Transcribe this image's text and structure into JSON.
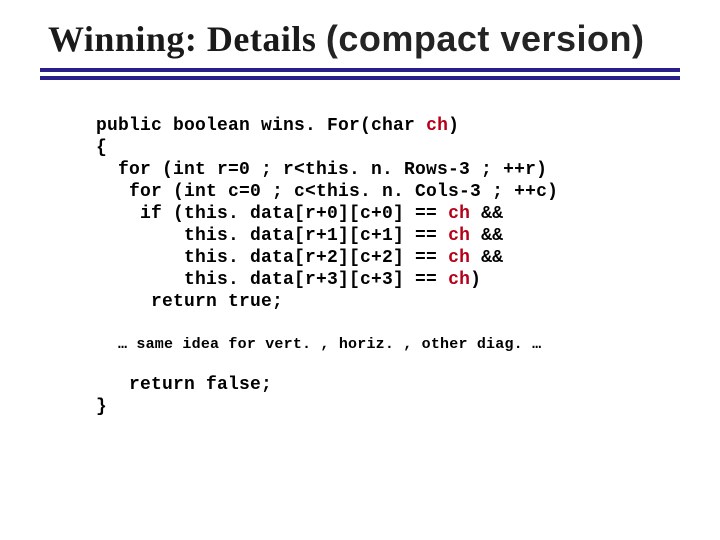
{
  "title": {
    "left": "Winning:  Details",
    "right": "(compact version)"
  },
  "code": {
    "l1a": "public boolean wins. For(char ",
    "l1b": "ch",
    "l1c": ")",
    "l2": "{",
    "l3": "  for (int r=0 ; r<this. n. Rows-3 ; ++r)",
    "l4": "   for (int c=0 ; c<this. n. Cols-3 ; ++c)",
    "l5a": "    if (this. data[r+0][c+0] == ",
    "l5b": "ch",
    "l5c": " &&",
    "l6a": "        this. data[r+1][c+1] == ",
    "l6b": "ch",
    "l6c": " &&",
    "l7a": "        this. data[r+2][c+2] == ",
    "l7b": "ch",
    "l7c": " &&",
    "l8a": "        this. data[r+3][c+3] == ",
    "l8b": "ch",
    "l8c": ")",
    "l9": "     return true;",
    "note": "… same idea for vert. , horiz. , other diag. …",
    "l10": "   return false;",
    "l11": "}"
  }
}
